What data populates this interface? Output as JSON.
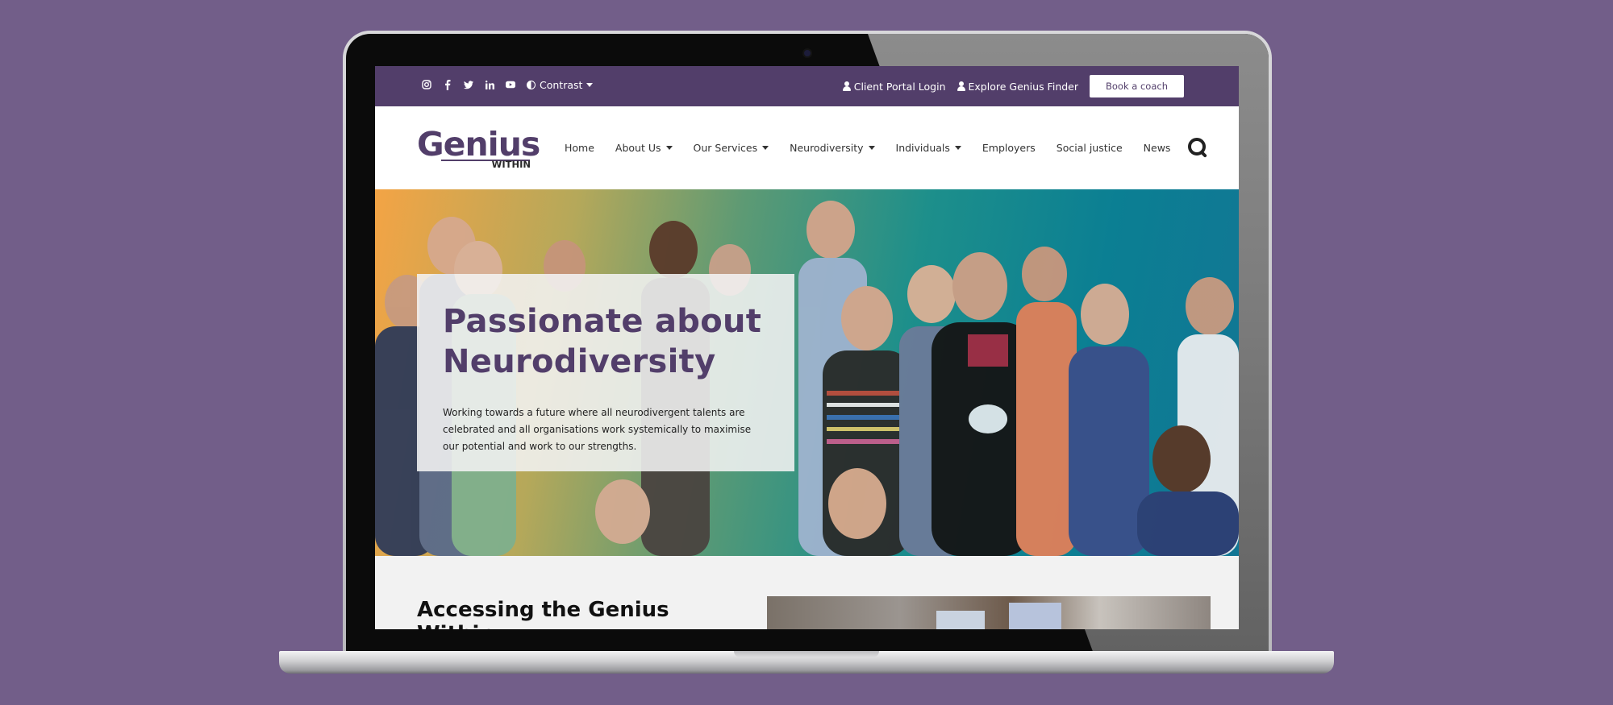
{
  "colors": {
    "background": "#725e89",
    "brand_purple": "#523e6a",
    "topbar": "#523e6a",
    "nav_bg": "#ffffff",
    "section_bg": "#f2f2f2"
  },
  "topbar": {
    "social_icons": [
      "instagram-icon",
      "facebook-icon",
      "twitter-icon",
      "linkedin-icon",
      "youtube-icon"
    ],
    "contrast_label": "Contrast",
    "client_portal_label": "Client Portal Login",
    "explore_label": "Explore Genius Finder",
    "book_label": "Book a coach"
  },
  "logo": {
    "main": "Genius",
    "sub": "WITHIN"
  },
  "nav": {
    "items": [
      {
        "label": "Home",
        "dropdown": false
      },
      {
        "label": "About Us",
        "dropdown": true
      },
      {
        "label": "Our Services",
        "dropdown": true
      },
      {
        "label": "Neurodiversity",
        "dropdown": true
      },
      {
        "label": "Individuals",
        "dropdown": true
      },
      {
        "label": "Employers",
        "dropdown": false
      },
      {
        "label": "Social justice",
        "dropdown": false
      },
      {
        "label": "News",
        "dropdown": false
      }
    ]
  },
  "hero": {
    "title_line1": "Passionate about",
    "title_line2": "Neurodiversity",
    "body": "Working towards a future where all neurodivergent talents are celebrated and all organisations work systemically to maximise our potential and work to our strengths."
  },
  "section": {
    "title": "Accessing the Genius Within"
  }
}
